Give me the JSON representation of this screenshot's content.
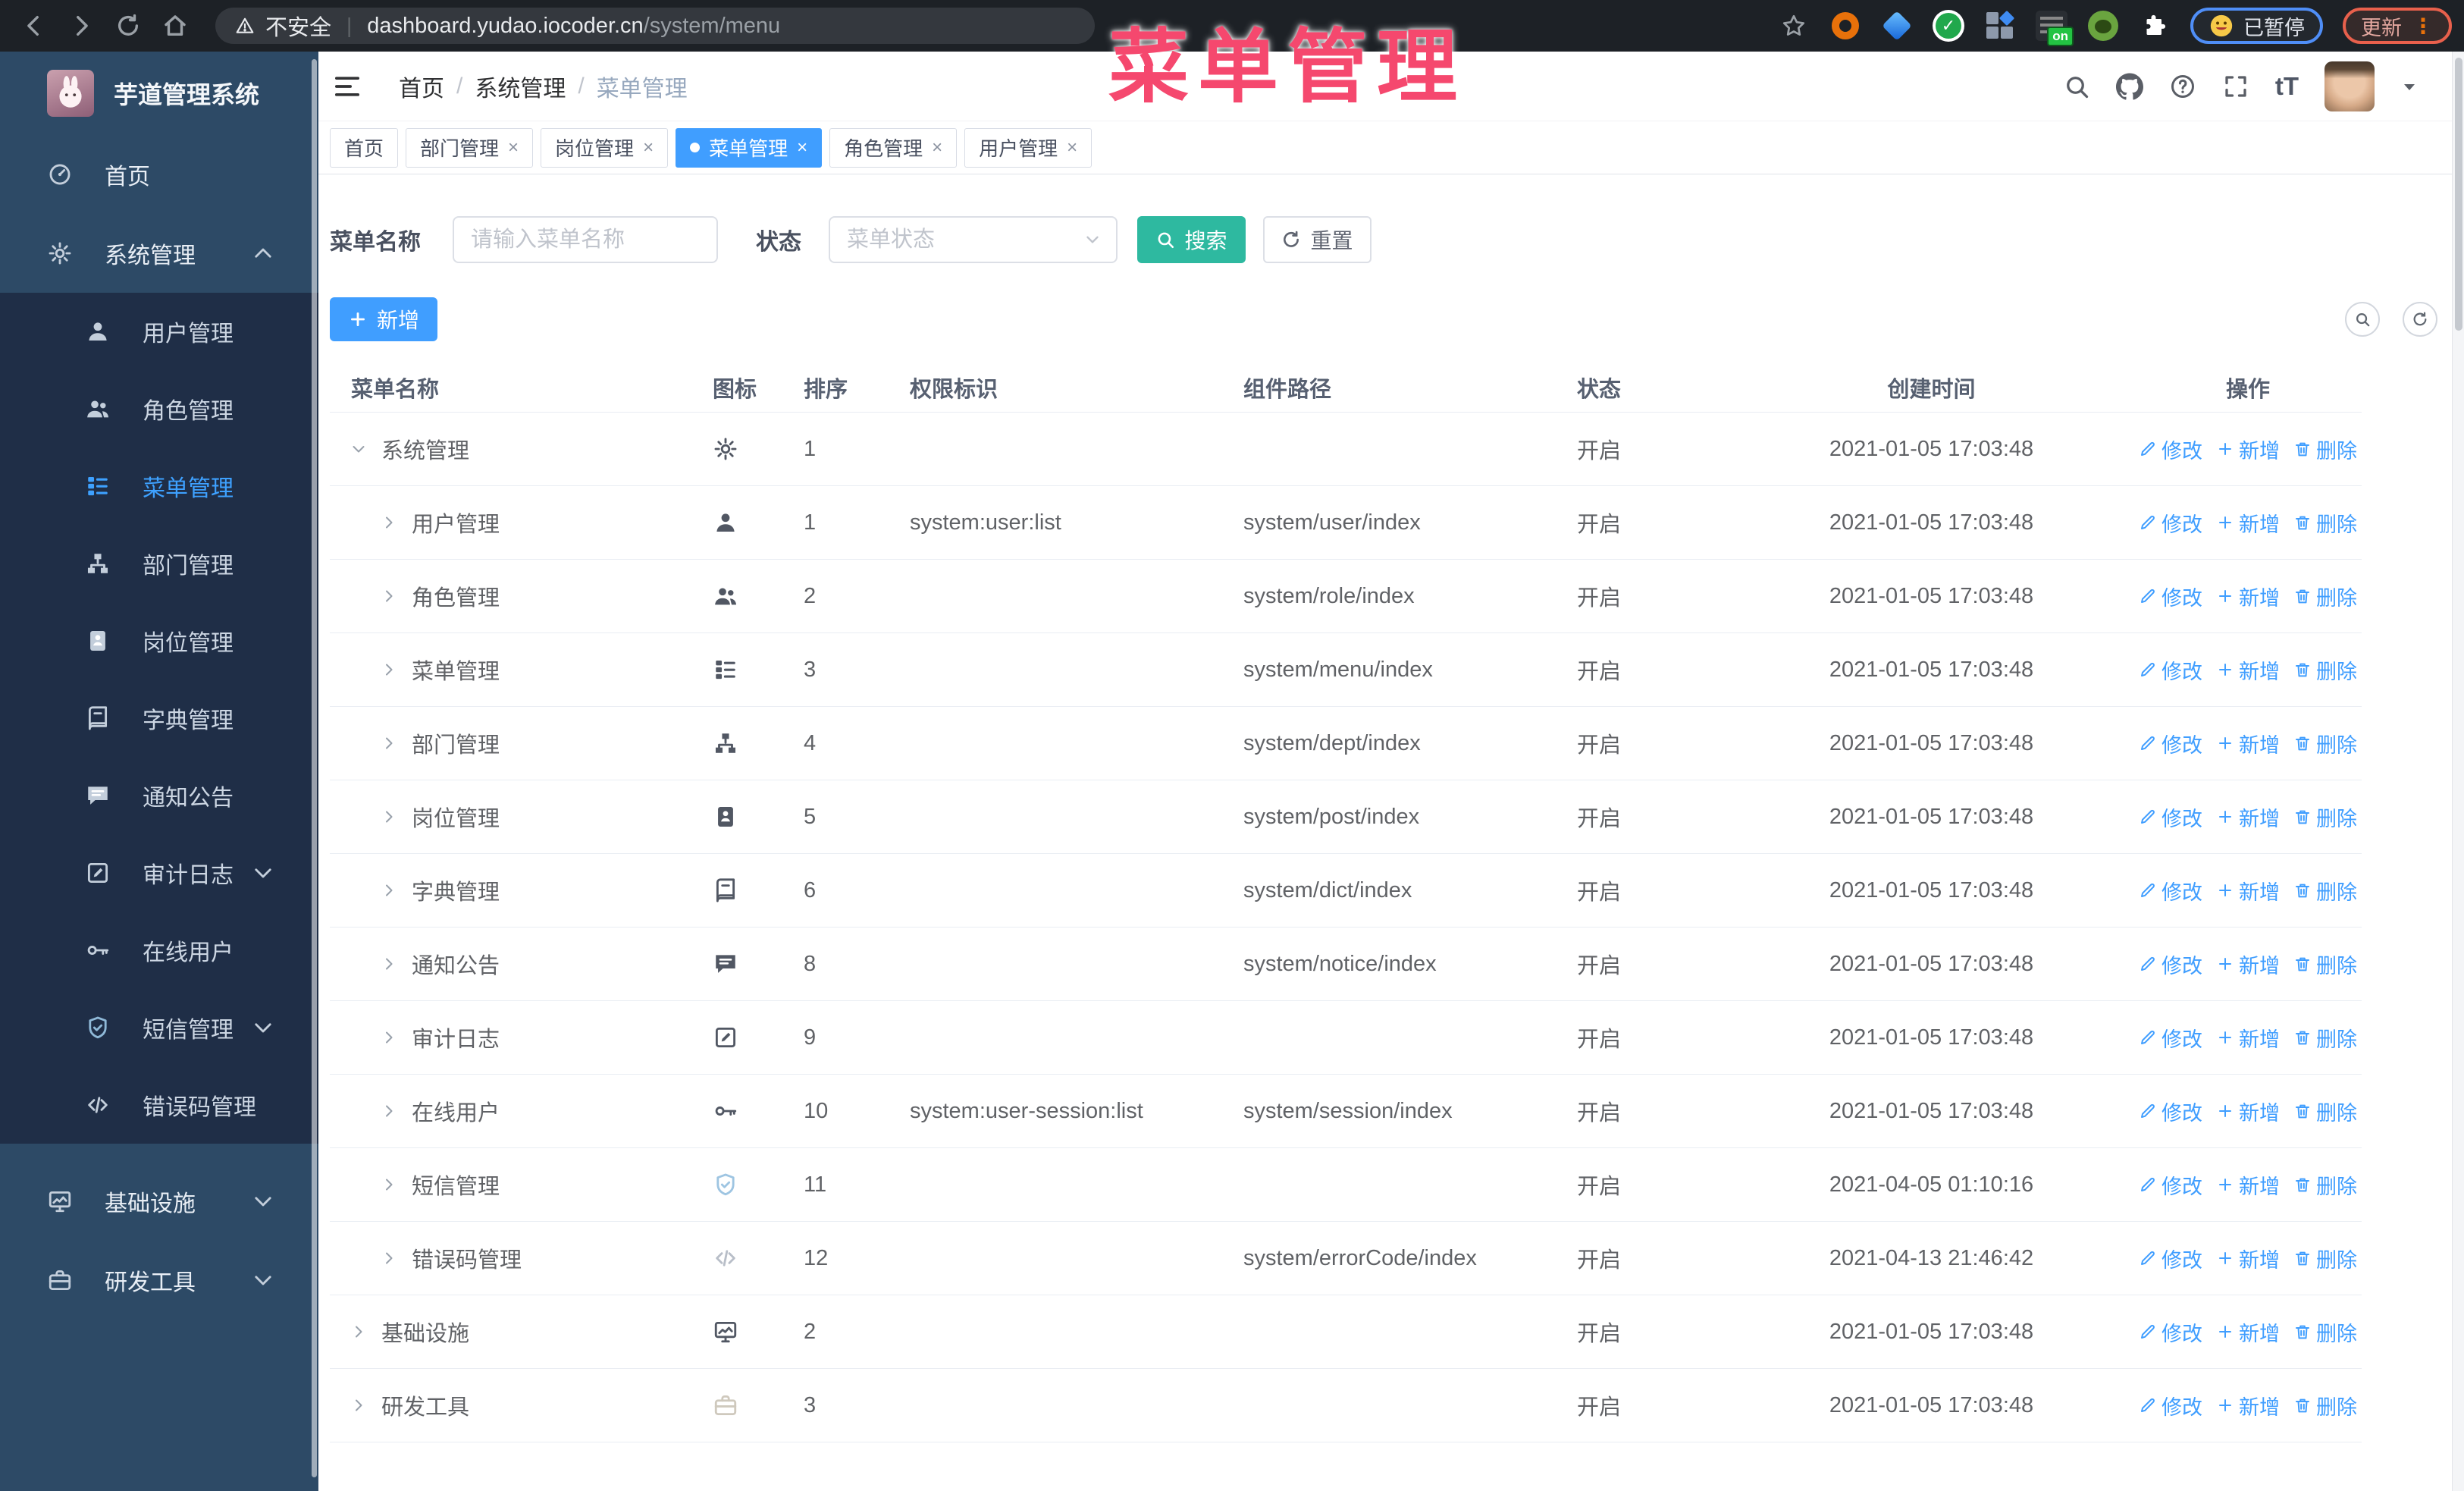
{
  "watermark": "菜单管理",
  "browser": {
    "security_label": "不安全",
    "url_host": "dashboard.yudao.iocoder.cn",
    "url_path": "/system/menu",
    "on_badge": "on",
    "paused_badge": "已暂停",
    "update_badge": "更新"
  },
  "colors": {
    "accent_blue": "#409eff",
    "search_teal": "#2eb9a0",
    "watermark_pink": "#f5486e",
    "sidebar_base": "#2d4a66",
    "sidebar_submenu": "#1f2e47",
    "sidebar_selected": "#3ea1ff"
  },
  "sidebar": {
    "logo_title": "芋道管理系统",
    "items": [
      {
        "icon": "dashboard",
        "label": "首页",
        "level": "root"
      },
      {
        "icon": "gear",
        "label": "系统管理",
        "level": "root",
        "chevron": "up",
        "active": true
      },
      {
        "icon": "user",
        "label": "用户管理",
        "level": "sub"
      },
      {
        "icon": "users",
        "label": "角色管理",
        "level": "sub"
      },
      {
        "icon": "menu-list",
        "label": "菜单管理",
        "level": "sub",
        "selected": true
      },
      {
        "icon": "org-tree",
        "label": "部门管理",
        "level": "sub"
      },
      {
        "icon": "id-badge",
        "label": "岗位管理",
        "level": "sub"
      },
      {
        "icon": "dictionary",
        "label": "字典管理",
        "level": "sub"
      },
      {
        "icon": "announcement",
        "label": "通知公告",
        "level": "sub"
      },
      {
        "icon": "audit-log",
        "label": "审计日志",
        "level": "sub",
        "chevron": "down"
      },
      {
        "icon": "online-key",
        "label": "在线用户",
        "level": "sub"
      },
      {
        "icon": "shield-check",
        "label": "短信管理",
        "level": "sub",
        "chevron": "down",
        "icon_color": "#8fb9d8"
      },
      {
        "icon": "error-code",
        "label": "错误码管理",
        "level": "sub"
      },
      {
        "icon": "infrastructure",
        "label": "基础设施",
        "level": "root",
        "chevron": "down",
        "gap_before": true
      },
      {
        "icon": "dev-tools",
        "label": "研发工具",
        "level": "root",
        "chevron": "down"
      }
    ]
  },
  "header": {
    "breadcrumb": [
      "首页",
      "系统管理",
      "菜单管理"
    ],
    "font_size_label": "tT"
  },
  "tabs": [
    {
      "label": "首页",
      "closable": false,
      "active": false
    },
    {
      "label": "部门管理",
      "closable": true,
      "active": false
    },
    {
      "label": "岗位管理",
      "closable": true,
      "active": false
    },
    {
      "label": "菜单管理",
      "closable": true,
      "active": true
    },
    {
      "label": "角色管理",
      "closable": true,
      "active": false
    },
    {
      "label": "用户管理",
      "closable": true,
      "active": false
    }
  ],
  "filters": {
    "name_label": "菜单名称",
    "name_placeholder": "请输入菜单名称",
    "status_label": "状态",
    "status_placeholder": "菜单状态",
    "search_label": "搜索",
    "reset_label": "重置"
  },
  "toolbar": {
    "add_label": "新增"
  },
  "table": {
    "columns": [
      "菜单名称",
      "图标",
      "排序",
      "权限标识",
      "组件路径",
      "状态",
      "创建时间",
      "操作"
    ],
    "actions": {
      "edit": "修改",
      "add": "新增",
      "delete": "删除"
    },
    "rows": [
      {
        "name": "系统管理",
        "depth": 0,
        "expand": "down",
        "icon": "gear",
        "sort": "1",
        "perm": "",
        "path": "",
        "status": "开启",
        "created": "2021-01-05 17:03:48"
      },
      {
        "name": "用户管理",
        "depth": 1,
        "expand": "right",
        "icon": "user",
        "sort": "1",
        "perm": "system:user:list",
        "path": "system/user/index",
        "status": "开启",
        "created": "2021-01-05 17:03:48"
      },
      {
        "name": "角色管理",
        "depth": 1,
        "expand": "right",
        "icon": "users",
        "sort": "2",
        "perm": "",
        "path": "system/role/index",
        "status": "开启",
        "created": "2021-01-05 17:03:48"
      },
      {
        "name": "菜单管理",
        "depth": 1,
        "expand": "right",
        "icon": "menu-list",
        "sort": "3",
        "perm": "",
        "path": "system/menu/index",
        "status": "开启",
        "created": "2021-01-05 17:03:48"
      },
      {
        "name": "部门管理",
        "depth": 1,
        "expand": "right",
        "icon": "org-tree",
        "sort": "4",
        "perm": "",
        "path": "system/dept/index",
        "status": "开启",
        "created": "2021-01-05 17:03:48"
      },
      {
        "name": "岗位管理",
        "depth": 1,
        "expand": "right",
        "icon": "id-badge",
        "sort": "5",
        "perm": "",
        "path": "system/post/index",
        "status": "开启",
        "created": "2021-01-05 17:03:48"
      },
      {
        "name": "字典管理",
        "depth": 1,
        "expand": "right",
        "icon": "dictionary",
        "sort": "6",
        "perm": "",
        "path": "system/dict/index",
        "status": "开启",
        "created": "2021-01-05 17:03:48"
      },
      {
        "name": "通知公告",
        "depth": 1,
        "expand": "right",
        "icon": "announcement",
        "sort": "8",
        "perm": "",
        "path": "system/notice/index",
        "status": "开启",
        "created": "2021-01-05 17:03:48"
      },
      {
        "name": "审计日志",
        "depth": 1,
        "expand": "right",
        "icon": "audit-log",
        "sort": "9",
        "perm": "",
        "path": "",
        "status": "开启",
        "created": "2021-01-05 17:03:48"
      },
      {
        "name": "在线用户",
        "depth": 1,
        "expand": "right",
        "icon": "online-key",
        "sort": "10",
        "perm": "system:user-session:list",
        "path": "system/session/index",
        "status": "开启",
        "created": "2021-01-05 17:03:48"
      },
      {
        "name": "短信管理",
        "depth": 1,
        "expand": "right",
        "icon": "shield-check",
        "sort": "11",
        "perm": "",
        "path": "",
        "status": "开启",
        "created": "2021-04-05 01:10:16",
        "icon_color": "#9ec5e2"
      },
      {
        "name": "错误码管理",
        "depth": 1,
        "expand": "right",
        "icon": "error-code",
        "sort": "12",
        "perm": "",
        "path": "system/errorCode/index",
        "status": "开启",
        "created": "2021-04-13 21:46:42",
        "icon_color": "#b8bec8"
      },
      {
        "name": "基础设施",
        "depth": 0,
        "expand": "right",
        "icon": "infrastructure",
        "sort": "2",
        "perm": "",
        "path": "",
        "status": "开启",
        "created": "2021-01-05 17:03:48"
      },
      {
        "name": "研发工具",
        "depth": 0,
        "expand": "right",
        "icon": "dev-tools",
        "sort": "3",
        "perm": "",
        "path": "",
        "status": "开启",
        "created": "2021-01-05 17:03:48",
        "icon_color": "#cfc9bd"
      }
    ]
  }
}
